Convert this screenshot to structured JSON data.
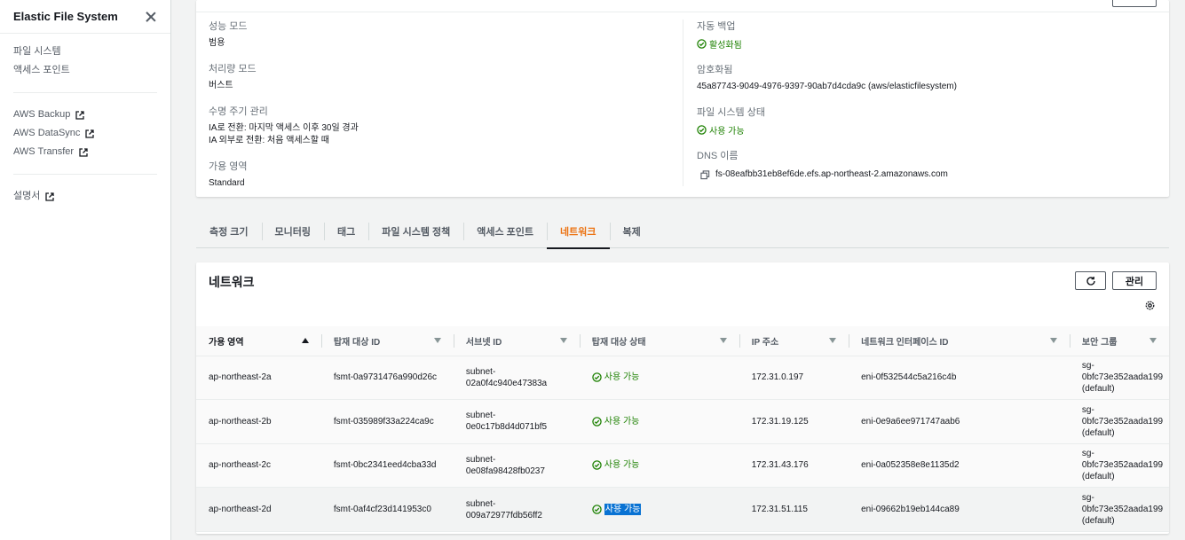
{
  "sidebar": {
    "title": "Elastic File System",
    "nav_primary": [
      {
        "label": "파일 시스템"
      },
      {
        "label": "액세스 포인트"
      }
    ],
    "nav_services": [
      {
        "label": "AWS Backup"
      },
      {
        "label": "AWS DataSync"
      },
      {
        "label": "AWS Transfer"
      }
    ],
    "nav_docs": [
      {
        "label": "설명서"
      }
    ]
  },
  "details": {
    "left": [
      {
        "label": "성능 모드",
        "value": "범용"
      },
      {
        "label": "처리량 모드",
        "value": "버스트"
      },
      {
        "label": "수명 주기 관리",
        "value": "IA로 전환: 마지막 액세스 이후 30일 경과",
        "value2": "IA 외부로 전환: 처음 액세스할 때"
      },
      {
        "label": "가용 영역",
        "value": "Standard"
      }
    ],
    "right": {
      "auto_backup_label": "자동 백업",
      "auto_backup_value": "활성화됨",
      "encryption_label": "암호화됨",
      "encryption_value": "45a87743-9049-4976-9397-90ab7d4cda9c (aws/elasticfilesystem)",
      "fs_state_label": "파일 시스템 상태",
      "fs_state_value": "사용 가능",
      "dns_label": "DNS 이름",
      "dns_value": "fs-08eafbb31eb8ef6de.efs.ap-northeast-2.amazonaws.com"
    }
  },
  "tabs": [
    {
      "label": "측정 크기",
      "active": false
    },
    {
      "label": "모니터링",
      "active": false
    },
    {
      "label": "태그",
      "active": false
    },
    {
      "label": "파일 시스템 정책",
      "active": false
    },
    {
      "label": "액세스 포인트",
      "active": false
    },
    {
      "label": "네트워크",
      "active": true
    },
    {
      "label": "복제",
      "active": false
    }
  ],
  "network": {
    "title": "네트워크",
    "manage_label": "관리",
    "columns": [
      "가용 영역",
      "탑재 대상 ID",
      "서브넷 ID",
      "탑재 대상 상태",
      "IP 주소",
      "네트워크 인터페이스 ID",
      "보안 그룹"
    ],
    "rows": [
      {
        "az": "ap-northeast-2a",
        "mt_id": "fsmt-0a9731476a990d26c",
        "subnet1": "subnet-",
        "subnet2": "02a0f4c940e47383a",
        "state": "사용 가능",
        "ip": "172.31.0.197",
        "eni": "eni-0f532544c5a216c4b",
        "sg1": "sg-",
        "sg2": "0bfc73e352aada199",
        "sg3": "(default)"
      },
      {
        "az": "ap-northeast-2b",
        "mt_id": "fsmt-035989f33a224ca9c",
        "subnet1": "subnet-",
        "subnet2": "0e0c17b8d4d071bf5",
        "state": "사용 가능",
        "ip": "172.31.19.125",
        "eni": "eni-0e9a6ee971747aab6",
        "sg1": "sg-",
        "sg2": "0bfc73e352aada199",
        "sg3": "(default)"
      },
      {
        "az": "ap-northeast-2c",
        "mt_id": "fsmt-0bc2341eed4cba33d",
        "subnet1": "subnet-",
        "subnet2": "0e08fa98428fb0237",
        "state": "사용 가능",
        "ip": "172.31.43.176",
        "eni": "eni-0a052358e8e1135d2",
        "sg1": "sg-",
        "sg2": "0bfc73e352aada199",
        "sg3": "(default)"
      },
      {
        "az": "ap-northeast-2d",
        "mt_id": "fsmt-0af4cf23d141953c0",
        "subnet1": "subnet-",
        "subnet2": "009a72977fdb56ff2",
        "state": "사용 가능",
        "ip": "172.31.51.115",
        "eni": "eni-09662b19eb144ca89",
        "sg1": "sg-",
        "sg2": "0bfc73e352aada199",
        "sg3": "(default)"
      }
    ]
  },
  "colors": {
    "accent": "#ec7211",
    "success": "#1d8102",
    "highlight": "#0972d3"
  }
}
